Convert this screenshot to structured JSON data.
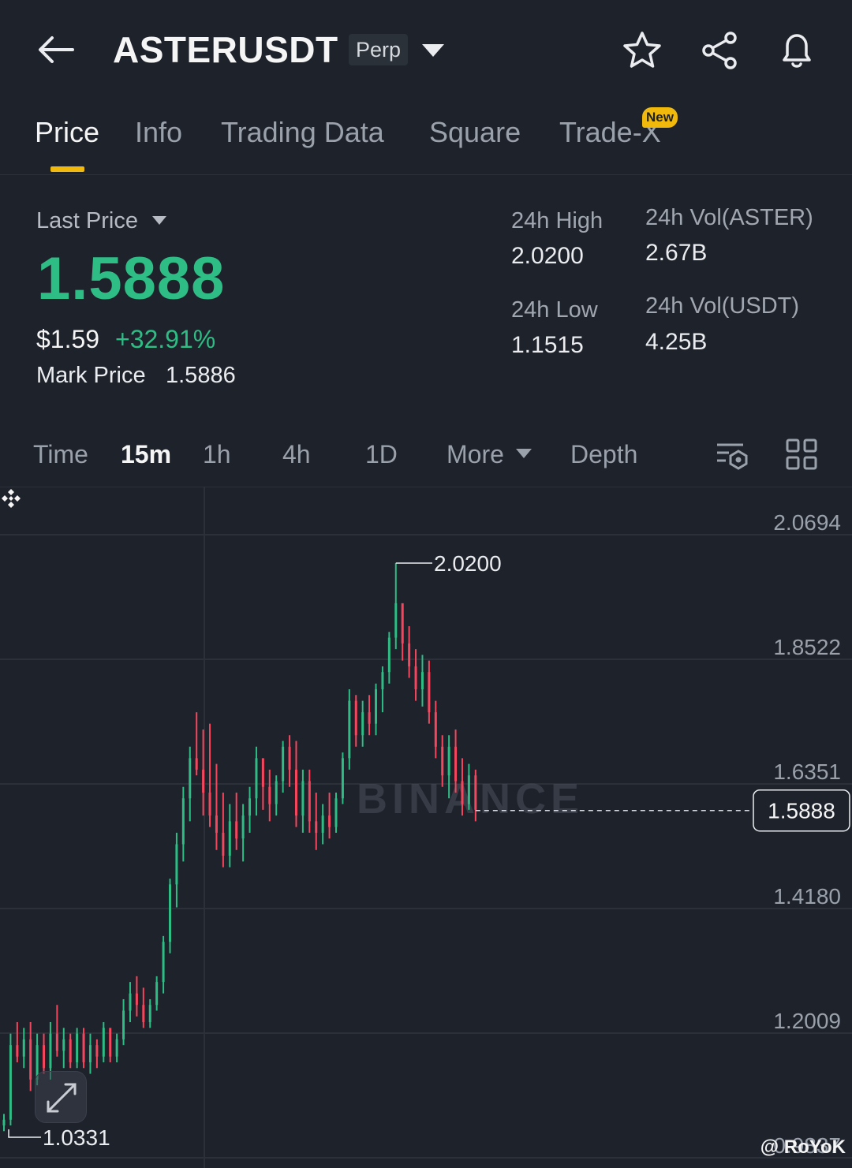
{
  "header": {
    "symbol": "ASTERUSDT",
    "contract_badge": "Perp",
    "icons": [
      "back-arrow-icon",
      "chevron-down-icon",
      "star-icon",
      "share-icon",
      "bell-icon"
    ]
  },
  "tabs": [
    {
      "label": "Price",
      "active": true
    },
    {
      "label": "Info"
    },
    {
      "label": "Trading Data"
    },
    {
      "label": "Square"
    },
    {
      "label": "Trade-X",
      "badge": "New"
    }
  ],
  "price": {
    "last_price_label": "Last Price",
    "last_price": "1.5888",
    "usd_price": "$1.59",
    "change_pct": "+32.91%",
    "mark_price_label": "Mark Price",
    "mark_price": "1.5886"
  },
  "stats": {
    "high_label": "24h High",
    "high": "2.0200",
    "low_label": "24h Low",
    "low": "1.1515",
    "vol_base_label": "24h Vol(ASTER)",
    "vol_base": "2.67B",
    "vol_quote_label": "24h Vol(USDT)",
    "vol_quote": "4.25B"
  },
  "intervals": {
    "items": [
      "Time",
      "15m",
      "1h",
      "4h",
      "1D",
      "More",
      "Depth"
    ],
    "active": "15m"
  },
  "colors": {
    "up": "#2ebd85",
    "down": "#f6465d",
    "accent": "#f0b90b",
    "bg": "#1e222b"
  },
  "chart_data": {
    "type": "candlestick",
    "y_ticks": [
      "2.0694",
      "1.8522",
      "1.6351",
      "1.4180",
      "1.2009",
      "0.9837"
    ],
    "ylim": [
      0.9837,
      2.0694
    ],
    "max_marker": "2.0200",
    "min_marker": "1.0331",
    "last_price": "1.5888",
    "watermark": "BINANCE",
    "candles": [
      [
        1.04,
        1.06,
        1.03,
        1.05
      ],
      [
        1.05,
        1.2,
        1.04,
        1.18
      ],
      [
        1.18,
        1.22,
        1.15,
        1.16
      ],
      [
        1.16,
        1.21,
        1.14,
        1.19
      ],
      [
        1.19,
        1.22,
        1.1,
        1.12
      ],
      [
        1.12,
        1.2,
        1.11,
        1.18
      ],
      [
        1.18,
        1.2,
        1.13,
        1.14
      ],
      [
        1.14,
        1.22,
        1.12,
        1.2
      ],
      [
        1.2,
        1.25,
        1.16,
        1.17
      ],
      [
        1.17,
        1.21,
        1.14,
        1.19
      ],
      [
        1.19,
        1.2,
        1.14,
        1.15
      ],
      [
        1.15,
        1.21,
        1.14,
        1.2
      ],
      [
        1.2,
        1.21,
        1.14,
        1.15
      ],
      [
        1.15,
        1.2,
        1.13,
        1.18
      ],
      [
        1.18,
        1.19,
        1.14,
        1.16
      ],
      [
        1.16,
        1.22,
        1.15,
        1.21
      ],
      [
        1.21,
        1.2,
        1.15,
        1.16
      ],
      [
        1.16,
        1.2,
        1.15,
        1.19
      ],
      [
        1.19,
        1.26,
        1.18,
        1.24
      ],
      [
        1.24,
        1.29,
        1.22,
        1.27
      ],
      [
        1.27,
        1.3,
        1.23,
        1.25
      ],
      [
        1.25,
        1.28,
        1.21,
        1.22
      ],
      [
        1.22,
        1.26,
        1.21,
        1.25
      ],
      [
        1.25,
        1.3,
        1.24,
        1.29
      ],
      [
        1.29,
        1.37,
        1.27,
        1.36
      ],
      [
        1.36,
        1.47,
        1.34,
        1.46
      ],
      [
        1.46,
        1.55,
        1.42,
        1.53
      ],
      [
        1.53,
        1.63,
        1.5,
        1.61
      ],
      [
        1.61,
        1.7,
        1.57,
        1.68
      ],
      [
        1.68,
        1.76,
        1.65,
        1.66
      ],
      [
        1.66,
        1.73,
        1.58,
        1.62
      ],
      [
        1.62,
        1.74,
        1.56,
        1.58
      ],
      [
        1.58,
        1.67,
        1.52,
        1.55
      ],
      [
        1.55,
        1.62,
        1.49,
        1.51
      ],
      [
        1.51,
        1.6,
        1.49,
        1.57
      ],
      [
        1.57,
        1.62,
        1.52,
        1.54
      ],
      [
        1.54,
        1.6,
        1.5,
        1.58
      ],
      [
        1.58,
        1.63,
        1.55,
        1.61
      ],
      [
        1.61,
        1.7,
        1.58,
        1.68
      ],
      [
        1.68,
        1.67,
        1.59,
        1.63
      ],
      [
        1.63,
        1.66,
        1.57,
        1.6
      ],
      [
        1.6,
        1.65,
        1.58,
        1.64
      ],
      [
        1.64,
        1.71,
        1.62,
        1.7
      ],
      [
        1.7,
        1.72,
        1.63,
        1.66
      ],
      [
        1.66,
        1.71,
        1.56,
        1.58
      ],
      [
        1.58,
        1.66,
        1.55,
        1.64
      ],
      [
        1.64,
        1.66,
        1.55,
        1.57
      ],
      [
        1.57,
        1.62,
        1.52,
        1.55
      ],
      [
        1.55,
        1.6,
        1.53,
        1.58
      ],
      [
        1.58,
        1.62,
        1.54,
        1.56
      ],
      [
        1.56,
        1.62,
        1.55,
        1.61
      ],
      [
        1.61,
        1.69,
        1.6,
        1.68
      ],
      [
        1.68,
        1.8,
        1.66,
        1.78
      ],
      [
        1.78,
        1.79,
        1.7,
        1.72
      ],
      [
        1.72,
        1.78,
        1.7,
        1.76
      ],
      [
        1.76,
        1.79,
        1.72,
        1.74
      ],
      [
        1.74,
        1.81,
        1.72,
        1.8
      ],
      [
        1.8,
        1.84,
        1.76,
        1.83
      ],
      [
        1.83,
        1.9,
        1.81,
        1.89
      ],
      [
        1.89,
        2.02,
        1.87,
        1.95
      ],
      [
        1.95,
        1.94,
        1.85,
        1.88
      ],
      [
        1.88,
        1.91,
        1.82,
        1.84
      ],
      [
        1.84,
        1.87,
        1.78,
        1.8
      ],
      [
        1.8,
        1.86,
        1.77,
        1.83
      ],
      [
        1.83,
        1.85,
        1.74,
        1.76
      ],
      [
        1.76,
        1.78,
        1.68,
        1.7
      ],
      [
        1.7,
        1.72,
        1.63,
        1.65
      ],
      [
        1.65,
        1.72,
        1.61,
        1.7
      ],
      [
        1.7,
        1.73,
        1.62,
        1.64
      ],
      [
        1.64,
        1.68,
        1.58,
        1.6
      ],
      [
        1.6,
        1.67,
        1.59,
        1.65
      ],
      [
        1.65,
        1.66,
        1.57,
        1.59
      ]
    ]
  },
  "credit": "@ RoYoK"
}
